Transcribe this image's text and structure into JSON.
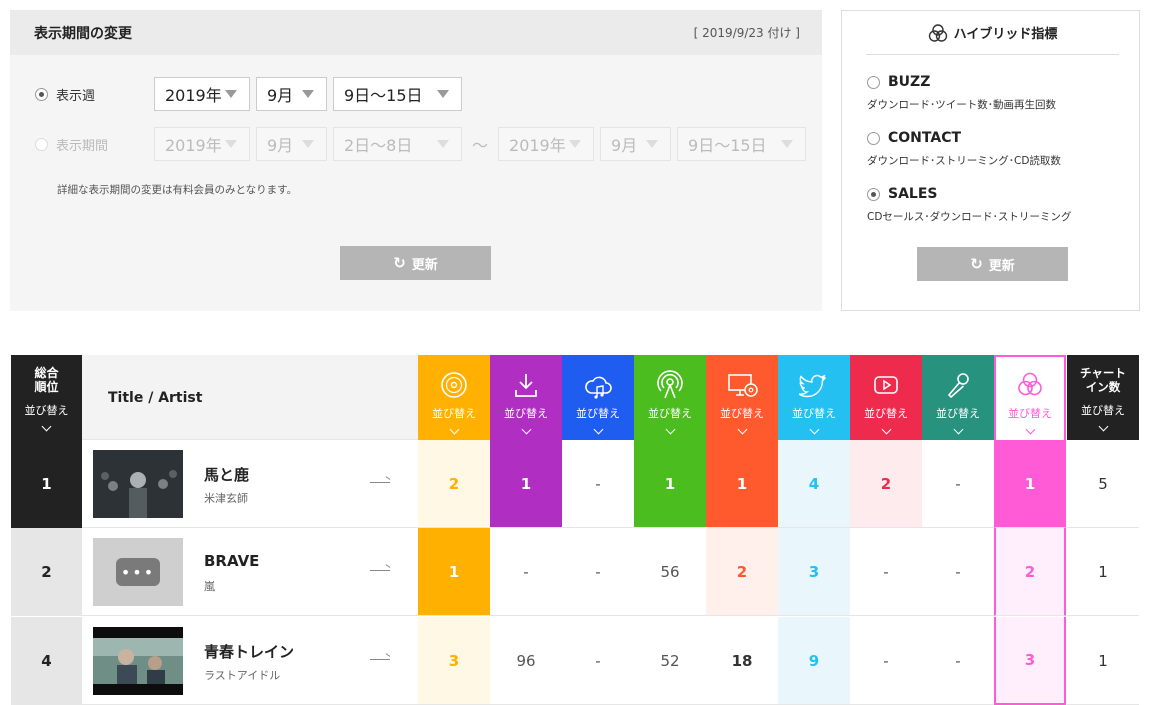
{
  "period": {
    "title": "表示期間の変更",
    "date": "[ 2019/9/23 付け ]",
    "week_label": "表示週",
    "range_label": "表示期間",
    "week": {
      "year": "2019年",
      "month": "9月",
      "days": "9日〜15日"
    },
    "range_from": {
      "year": "2019年",
      "month": "9月",
      "days": "2日〜8日"
    },
    "tilde": "〜",
    "range_to": {
      "year": "2019年",
      "month": "9月",
      "days": "9日〜15日"
    },
    "note": "詳細な表示期間の変更は有料会員のみとなります。",
    "update": "更新"
  },
  "hybrid": {
    "title": "ハイブリッド指標",
    "options": [
      {
        "name": "BUZZ",
        "desc": "ダウンロード･ツイート数･動画再生回数",
        "selected": false
      },
      {
        "name": "CONTACT",
        "desc": "ダウンロード･ストリーミング･CD読取数",
        "selected": false
      },
      {
        "name": "SALES",
        "desc": "CDセールス･ダウンロード･ストリーミング",
        "selected": true
      }
    ],
    "update": "更新"
  },
  "chart": {
    "rank_header": [
      "総合",
      "順位"
    ],
    "title_header": "Title / Artist",
    "sort_label": "並び替え",
    "chart_in_header": [
      "チャート",
      "イン数"
    ],
    "metric_icons": [
      "cd-icon",
      "download-icon",
      "cloud-music-icon",
      "radio-broadcast-icon",
      "pc-cd-icon",
      "twitter-icon",
      "youtube-icon",
      "karaoke-mic-icon",
      "hybrid-circles-icon"
    ],
    "metric_colors": [
      "#ffb000",
      "#b12ec3",
      "#1f5df0",
      "#4bbd1e",
      "#ff5a2e",
      "#24c0f2",
      "#ee2b4d",
      "#27927e",
      "#ff5bd6"
    ],
    "rows": [
      {
        "rank": "1",
        "title": "馬と鹿",
        "artist": "米津玄師",
        "metrics": [
          "2",
          "1",
          "-",
          "1",
          "1",
          "4",
          "2",
          "-",
          "1"
        ],
        "chart_in": "5"
      },
      {
        "rank": "2",
        "title": "BRAVE",
        "artist": "嵐",
        "metrics": [
          "1",
          "-",
          "-",
          "56",
          "2",
          "3",
          "-",
          "-",
          "2"
        ],
        "chart_in": "1"
      },
      {
        "rank": "4",
        "title": "青春トレイン",
        "artist": "ラストアイドル",
        "metrics": [
          "3",
          "96",
          "-",
          "52",
          "18",
          "9",
          "-",
          "-",
          "3"
        ],
        "chart_in": "1"
      }
    ]
  }
}
